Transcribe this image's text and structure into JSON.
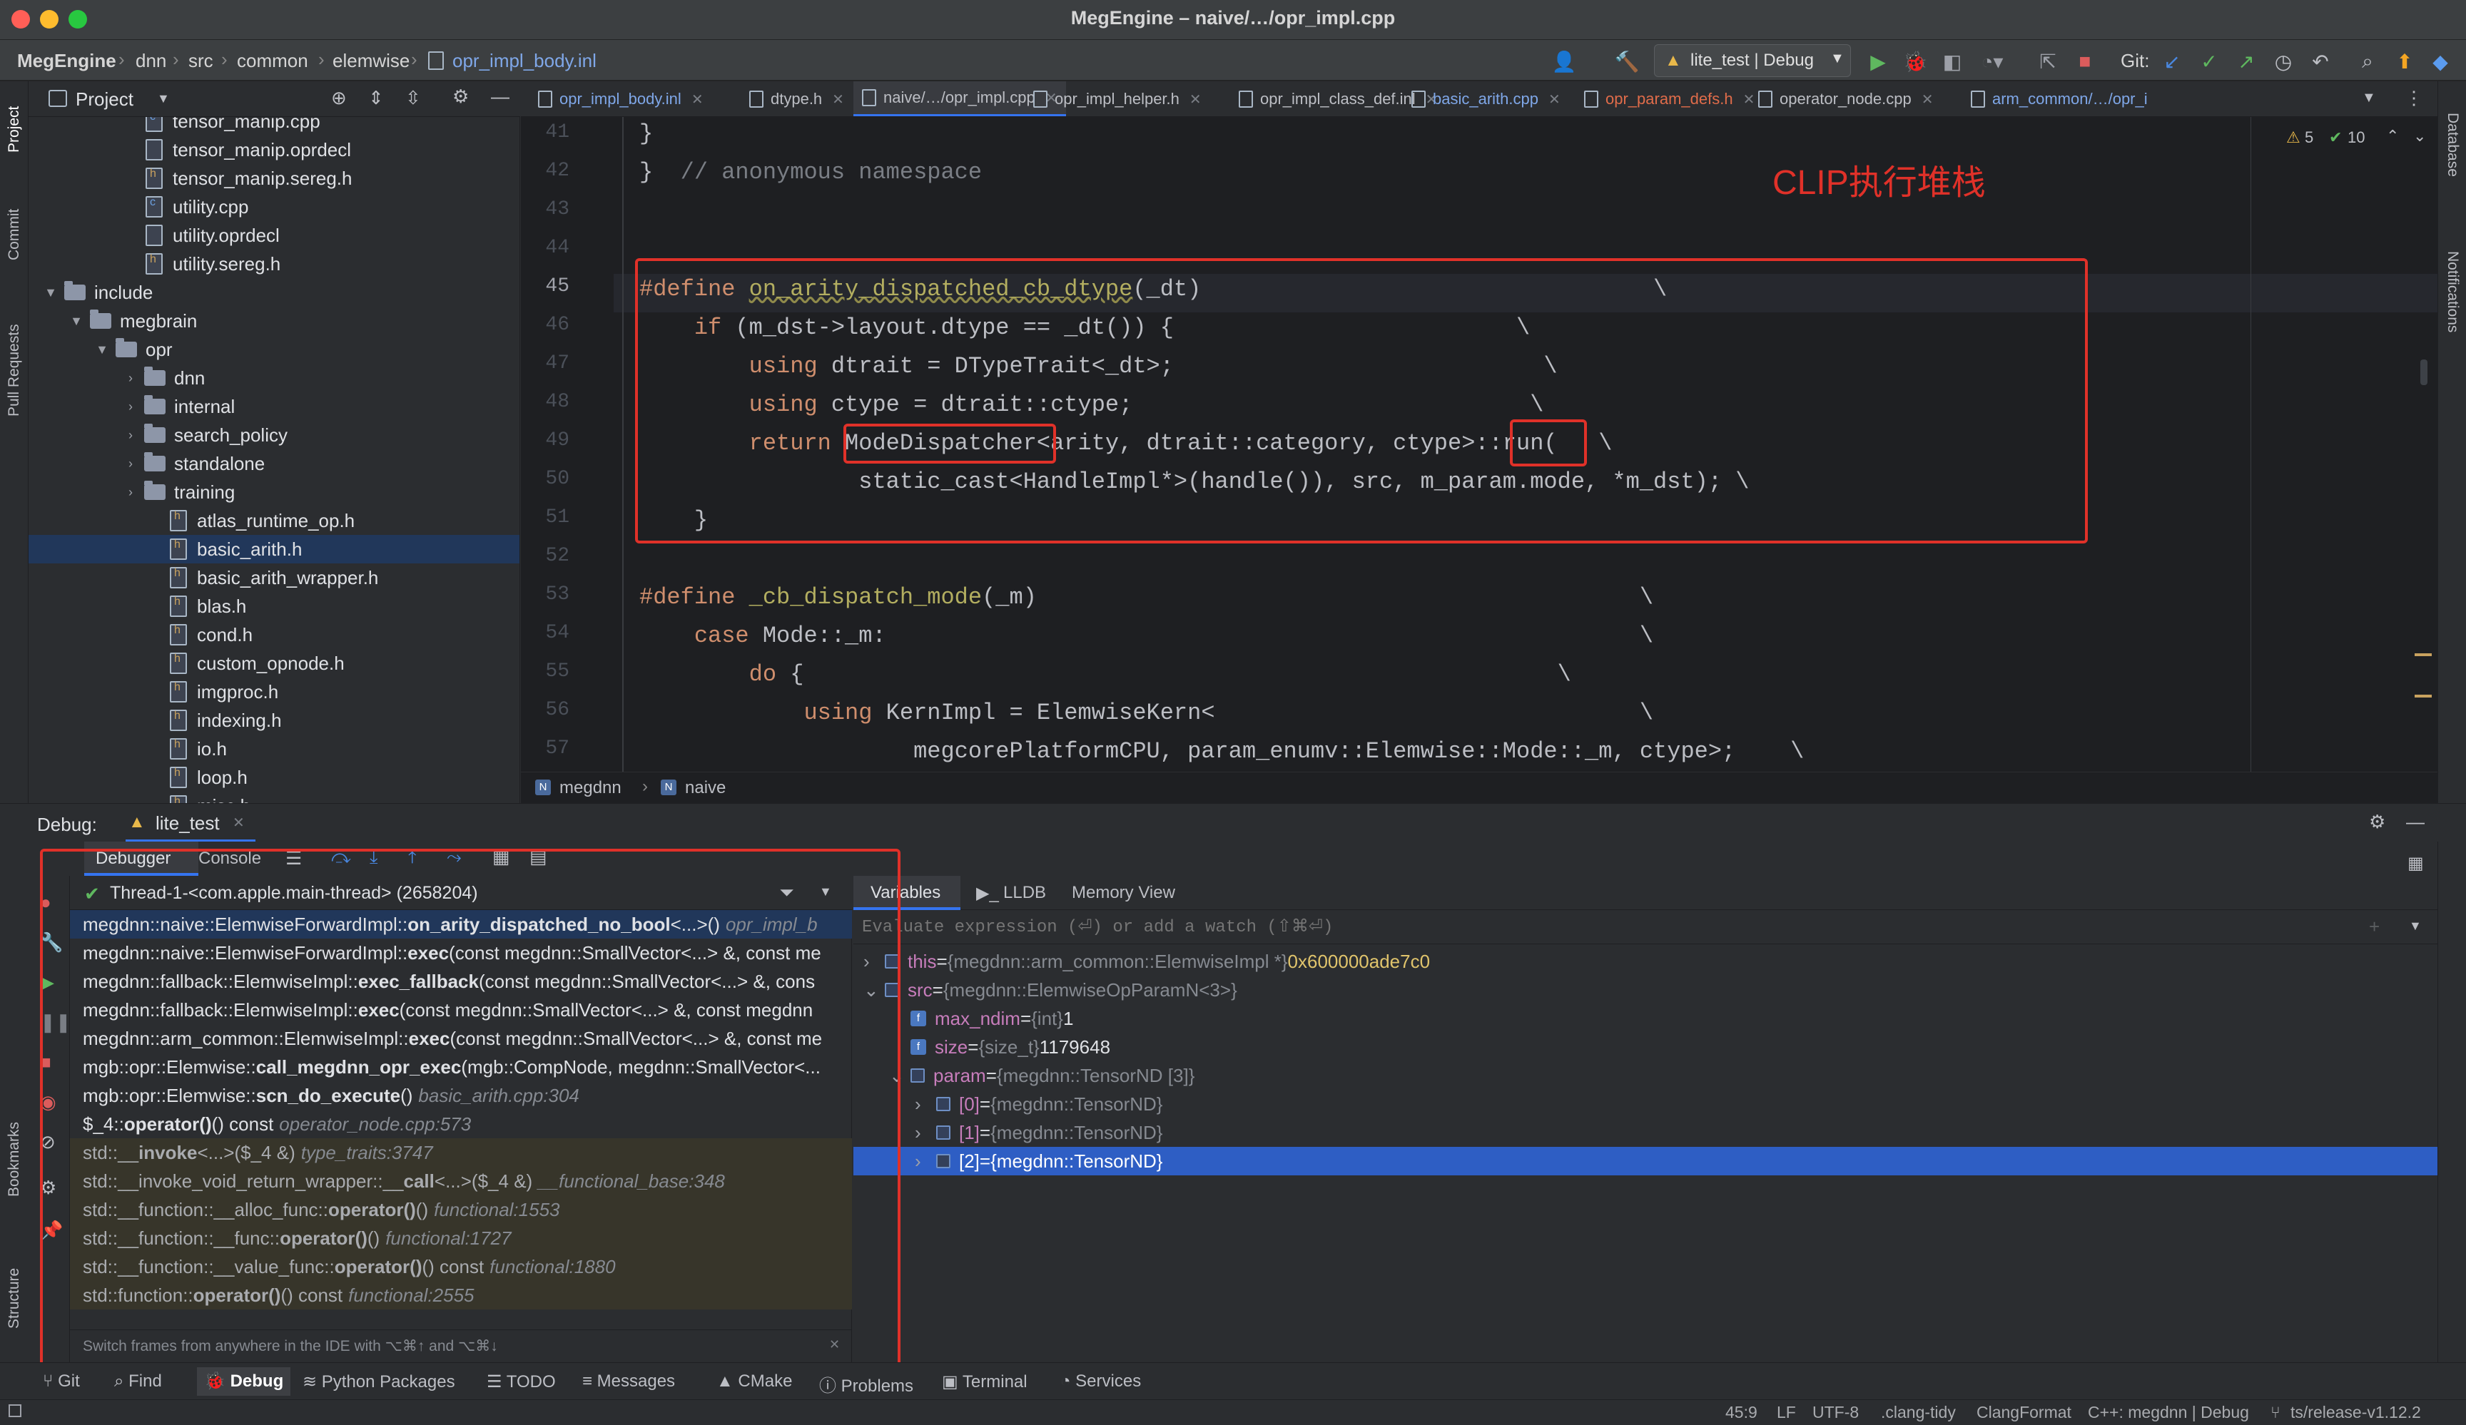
{
  "window": {
    "title": "MegEngine – naive/…/opr_impl.cpp"
  },
  "navbar": {
    "breadcrumbs": [
      "MegEngine",
      "dnn",
      "src",
      "common",
      "elemwise",
      "opr_impl_body.inl"
    ],
    "run_config": "lite_test | Debug",
    "git_label": "Git:"
  },
  "project": {
    "title": "Project",
    "tree": [
      {
        "label": "tensor_manip.cpp",
        "kind": "file-c"
      },
      {
        "label": "tensor_manip.oprdecl",
        "kind": "file"
      },
      {
        "label": "tensor_manip.sereg.h",
        "kind": "file-h"
      },
      {
        "label": "utility.cpp",
        "kind": "file-c"
      },
      {
        "label": "utility.oprdecl",
        "kind": "file"
      },
      {
        "label": "utility.sereg.h",
        "kind": "file-h"
      },
      {
        "label": "include",
        "kind": "folder"
      },
      {
        "label": "megbrain",
        "kind": "folder"
      },
      {
        "label": "opr",
        "kind": "folder"
      },
      {
        "label": "dnn",
        "kind": "folder"
      },
      {
        "label": "internal",
        "kind": "folder"
      },
      {
        "label": "search_policy",
        "kind": "folder"
      },
      {
        "label": "standalone",
        "kind": "folder"
      },
      {
        "label": "training",
        "kind": "folder"
      },
      {
        "label": "atlas_runtime_op.h",
        "kind": "file-h"
      },
      {
        "label": "basic_arith.h",
        "kind": "file-h"
      },
      {
        "label": "basic_arith_wrapper.h",
        "kind": "file-h"
      },
      {
        "label": "blas.h",
        "kind": "file-h"
      },
      {
        "label": "cond.h",
        "kind": "file-h"
      },
      {
        "label": "custom_opnode.h",
        "kind": "file-h"
      },
      {
        "label": "imgproc.h",
        "kind": "file-h"
      },
      {
        "label": "indexing.h",
        "kind": "file-h"
      },
      {
        "label": "io.h",
        "kind": "file-h"
      },
      {
        "label": "loop.h",
        "kind": "file-h"
      },
      {
        "label": "misc.h",
        "kind": "file-h"
      }
    ]
  },
  "tabs": [
    {
      "label": "opr_impl_body.inl"
    },
    {
      "label": "dtype.h"
    },
    {
      "label": "naive/…/opr_impl.cpp"
    },
    {
      "label": "opr_impl_helper.h"
    },
    {
      "label": "opr_impl_class_def.inl"
    },
    {
      "label": "basic_arith.cpp"
    },
    {
      "label": "opr_param_defs.h"
    },
    {
      "label": "operator_node.cpp"
    },
    {
      "label": "arm_common/…/opr_i"
    }
  ],
  "editor": {
    "warnings": "5",
    "checks": "10",
    "line_numbers": [
      "41",
      "42",
      "43",
      "44",
      "45",
      "46",
      "47",
      "48",
      "49",
      "50",
      "51",
      "52",
      "53",
      "54",
      "55",
      "56",
      "57"
    ],
    "breadcrumb": [
      "megdnn",
      "naive"
    ]
  },
  "annotation": "CLIP执行堆栈",
  "debug": {
    "label": "Debug:",
    "session": "lite_test",
    "tabs": [
      "Debugger",
      "Console"
    ],
    "thread": "Thread-1-<com.apple.main-thread> (2658204)",
    "frames": [
      {
        "pre": "megdnn::naive::ElemwiseForwardImpl::",
        "bold": "on_arity_dispatched_no_bool",
        "post": "<...>()",
        "loc": "opr_impl_b"
      },
      {
        "pre": "megdnn::naive::ElemwiseForwardImpl::",
        "bold": "exec",
        "post": "(const megdnn::SmallVector<...> &, const me",
        "loc": ""
      },
      {
        "pre": "megdnn::fallback::ElemwiseImpl::",
        "bold": "exec_fallback",
        "post": "(const megdnn::SmallVector<...> &, cons",
        "loc": ""
      },
      {
        "pre": "megdnn::fallback::ElemwiseImpl::",
        "bold": "exec",
        "post": "(const megdnn::SmallVector<...> &, const megdnn",
        "loc": ""
      },
      {
        "pre": "megdnn::arm_common::ElemwiseImpl::",
        "bold": "exec",
        "post": "(const megdnn::SmallVector<...> &, const me",
        "loc": ""
      },
      {
        "pre": "mgb::opr::Elemwise::",
        "bold": "call_megdnn_opr_exec",
        "post": "(mgb::CompNode, megdnn::SmallVector<...",
        "loc": ""
      },
      {
        "pre": "mgb::opr::Elemwise::",
        "bold": "scn_do_execute",
        "post": "()",
        "loc": "basic_arith.cpp:304"
      },
      {
        "pre": "$_4::",
        "bold": "operator()",
        "post": "() const",
        "loc": "operator_node.cpp:573"
      },
      {
        "pre": "std::__",
        "bold": "invoke",
        "post": "<...>($_4 &)",
        "loc": "type_traits:3747"
      },
      {
        "pre": "std::__invoke_void_return_wrapper::__",
        "bold": "call",
        "post": "<...>($_4 &)",
        "loc": "__functional_base:348"
      },
      {
        "pre": "std::__function::__alloc_func::",
        "bold": "operator()",
        "post": "()",
        "loc": "functional:1553"
      },
      {
        "pre": "std::__function::__func::",
        "bold": "operator()",
        "post": "()",
        "loc": "functional:1727"
      },
      {
        "pre": "std::__function::__value_func::",
        "bold": "operator()",
        "post": "() const",
        "loc": "functional:1880"
      },
      {
        "pre": "std::function::",
        "bold": "operator()",
        "post": "() const",
        "loc": "functional:2555"
      }
    ],
    "hint": "Switch frames from anywhere in the IDE with ⌥⌘↑ and ⌥⌘↓",
    "var_tabs": [
      "Variables",
      "LLDB",
      "Memory View"
    ],
    "eval_placeholder": "Evaluate expression (⏎) or add a watch (⇧⌘⏎)",
    "vars": [
      {
        "name": "this",
        "type": "{megdnn::arm_common::ElemwiseImpl *}",
        "value": "0x600000ade7c0"
      },
      {
        "name": "src",
        "type": "{megdnn::ElemwiseOpParamN<3>}",
        "value": ""
      },
      {
        "name": "max_ndim",
        "type": "{int}",
        "value": "1"
      },
      {
        "name": "size",
        "type": "{size_t}",
        "value": "1179648"
      },
      {
        "name": "param",
        "type": "{megdnn::TensorND [3]}",
        "value": ""
      },
      {
        "name": "[0]",
        "type": "{megdnn::TensorND}",
        "value": ""
      },
      {
        "name": "[1]",
        "type": "{megdnn::TensorND}",
        "value": ""
      },
      {
        "name": "[2]",
        "type": "{megdnn::TensorND}",
        "value": ""
      }
    ]
  },
  "bottom_tools": [
    "Git",
    "Find",
    "Debug",
    "Python Packages",
    "TODO",
    "Messages",
    "CMake",
    "Problems",
    "Terminal",
    "Services"
  ],
  "status": {
    "position": "45:9",
    "line_sep": "LF",
    "encoding": "UTF-8",
    "linter": ".clang-tidy",
    "formatter": "ClangFormat",
    "context": "C++: megdnn | Debug",
    "branch": "ts/release-v1.12.2"
  },
  "left_tools": [
    "Project",
    "Commit",
    "Pull Requests",
    "Bookmarks",
    "Structure"
  ],
  "right_tools": [
    "Database",
    "Notifications"
  ],
  "colors": {
    "accent": "#3574f0",
    "annotation": "#e03129",
    "selection": "#2e5ec4"
  }
}
